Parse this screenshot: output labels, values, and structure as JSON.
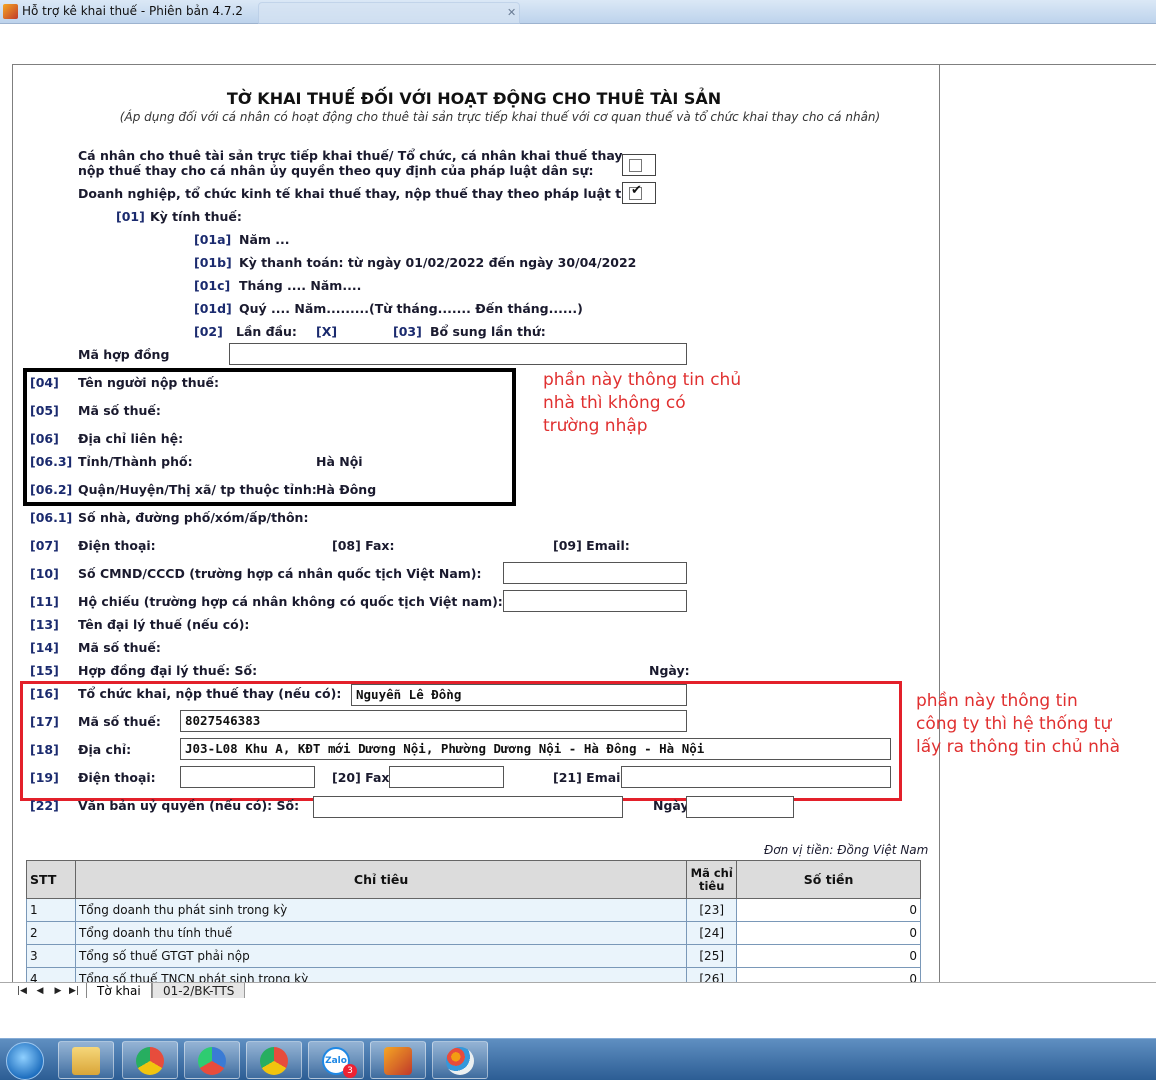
{
  "window": {
    "title": "Hỗ trợ kê khai thuế -  Phiên bản 4.7.2"
  },
  "form": {
    "title": "TỜ KHAI THUẾ ĐỐI VỚI HOẠT ĐỘNG CHO THUÊ TÀI SẢN",
    "subtitle": "(Áp dụng đối với cá nhân có hoạt động cho thuê tài sản trực tiếp khai thuế với cơ quan thuế và tổ chức khai thay cho cá nhân)",
    "opt1_line1": "Cá nhân cho thuê tài sản trực tiếp khai thuế/ Tổ chức, cá nhân khai thuế thay,",
    "opt1_line2": "nộp thuế thay cho cá nhân ủy quyền theo quy định của pháp luật dân sự:",
    "opt2": "Doanh nghiệp, tổ chức kinh tế khai thuế thay, nộp thuế thay theo pháp luật thuế:",
    "opt1_checked": false,
    "opt2_checked": true,
    "c01": "[01]",
    "c01_label": "Kỳ tính thuế:",
    "c01a": "[01a]",
    "c01a_label": "Năm ...",
    "c01b": "[01b]",
    "c01b_label": "Kỳ thanh toán:  từ ngày 01/02/2022 đến ngày 30/04/2022",
    "c01c": "[01c]",
    "c01c_label": "Tháng .... Năm....",
    "c01d": "[01d]",
    "c01d_label": "Quý .... Năm.........(Từ tháng....... Đến tháng......)",
    "c02": "[02]",
    "c02_label": "Lần đầu:",
    "c02_value": "[X]",
    "c03": "[03]",
    "c03_label": "Bổ sung lần thứ:",
    "contract_label": "Mã hợp đồng",
    "contract_value": "",
    "c04": "[04]",
    "c04_label": "Tên người nộp thuế:",
    "c05": "[05]",
    "c05_label": "Mã số thuế:",
    "c06": "[06]",
    "c06_label": "Địa chỉ liên hệ:",
    "c063": "[06.3]",
    "c063_label": "Tỉnh/Thành phố:",
    "c063_value": "Hà Nội",
    "c062": "[06.2]",
    "c062_label": "Quận/Huyện/Thị xã/ tp thuộc tỉnh:",
    "c062_value": "Hà Đông",
    "c061": "[06.1]",
    "c061_label": "Số nhà, đường phố/xóm/ấp/thôn:",
    "c07": "[07]",
    "c07_label": "Điện thoại:",
    "c08_label": "[08] Fax:",
    "c09_label": "[09] Email:",
    "c10": "[10]",
    "c10_label": "Số CMND/CCCD (trường hợp cá nhân quốc tịch Việt Nam):",
    "c10_value": "",
    "c11": "[11]",
    "c11_label": "Hộ chiếu (trường hợp cá nhân không có quốc tịch Việt nam):",
    "c11_value": "",
    "c13": "[13]",
    "c13_label": "Tên đại lý thuế (nếu có):",
    "c14": "[14]",
    "c14_label": "Mã số thuế:",
    "c15": "[15]",
    "c15_label": "Hợp đồng đại lý thuế: Số:",
    "c15_date": "Ngày:",
    "c16": "[16]",
    "c16_label": "Tổ chức khai, nộp thuế thay (nếu có):",
    "c16_value": "Nguyễn Lê Đồng",
    "c17": "[17]",
    "c17_label": "Mã số thuế:",
    "c17_value": "8027546383",
    "c18": "[18]",
    "c18_label": "Địa chỉ:",
    "c18_value": "J03-L08 Khu A, KĐT mới Dương Nội, Phường Dương Nội - Hà Đông - Hà Nội",
    "c19": "[19]",
    "c19_label": "Điện thoại:",
    "c19_value": "",
    "c20_label": "[20] Fax:",
    "c20_value": "",
    "c21_label": "[21] Email:",
    "c21_value": "",
    "c22": "[22]",
    "c22_label": "Văn bản uỷ quyền (nếu có): Số:",
    "c22_value": "",
    "c22_date": "Ngày",
    "c22_date_value": "",
    "currency_note": "Đơn vị tiền: Đồng Việt Nam"
  },
  "annotations": {
    "note1": [
      "phần này thông tin chủ",
      "nhà thì không có",
      "trường nhập"
    ],
    "note2": [
      "phần này thông tin",
      "công ty thì hệ thống tự",
      "lấy ra thông tin chủ nhà"
    ],
    "black_box_color": "#000000",
    "red_box_color": "#e3202a"
  },
  "table": {
    "headers": {
      "stt": "STT",
      "indicator": "Chỉ tiêu",
      "code": "Mã chỉ tiêu",
      "amount": "Số tiền"
    },
    "rows": [
      {
        "stt": "1",
        "indicator": "Tổng doanh thu phát sinh trong kỳ",
        "code": "[23]",
        "amount": "0"
      },
      {
        "stt": "2",
        "indicator": "Tổng doanh thu tính thuế",
        "code": "[24]",
        "amount": "0"
      },
      {
        "stt": "3",
        "indicator": "Tổng số thuế GTGT phải nộp",
        "code": "[25]",
        "amount": "0"
      },
      {
        "stt": "4",
        "indicator": "Tổng số thuế TNCN phát sinh trong kỳ",
        "code": "[26]",
        "amount": "0"
      }
    ]
  },
  "sheet_tabs": {
    "active": "Tờ khai",
    "other": "01-2/BK-TTS"
  },
  "taskbar": {
    "items": [
      "file-explorer",
      "chrome",
      "chromium",
      "chrome-profile",
      "zalo",
      "tax-app",
      "paint"
    ],
    "zalo_badge": "3",
    "zalo_label": "Zalo"
  }
}
